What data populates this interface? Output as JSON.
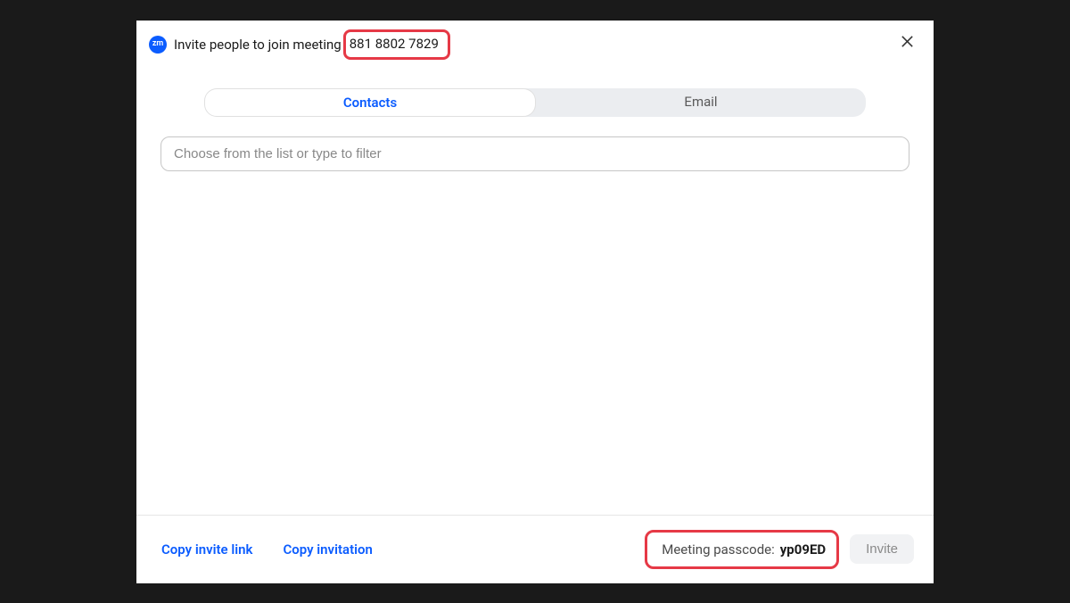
{
  "header": {
    "app_icon_label": "zm",
    "title_prefix": "Invite people to join meeting",
    "meeting_id": "881 8802 7829"
  },
  "tabs": {
    "contacts": "Contacts",
    "email": "Email"
  },
  "filter": {
    "placeholder": "Choose from the list or type to filter"
  },
  "footer": {
    "copy_link": "Copy invite link",
    "copy_invitation": "Copy invitation",
    "passcode_label": "Meeting passcode:",
    "passcode_value": "yp09ED",
    "invite_button": "Invite"
  }
}
